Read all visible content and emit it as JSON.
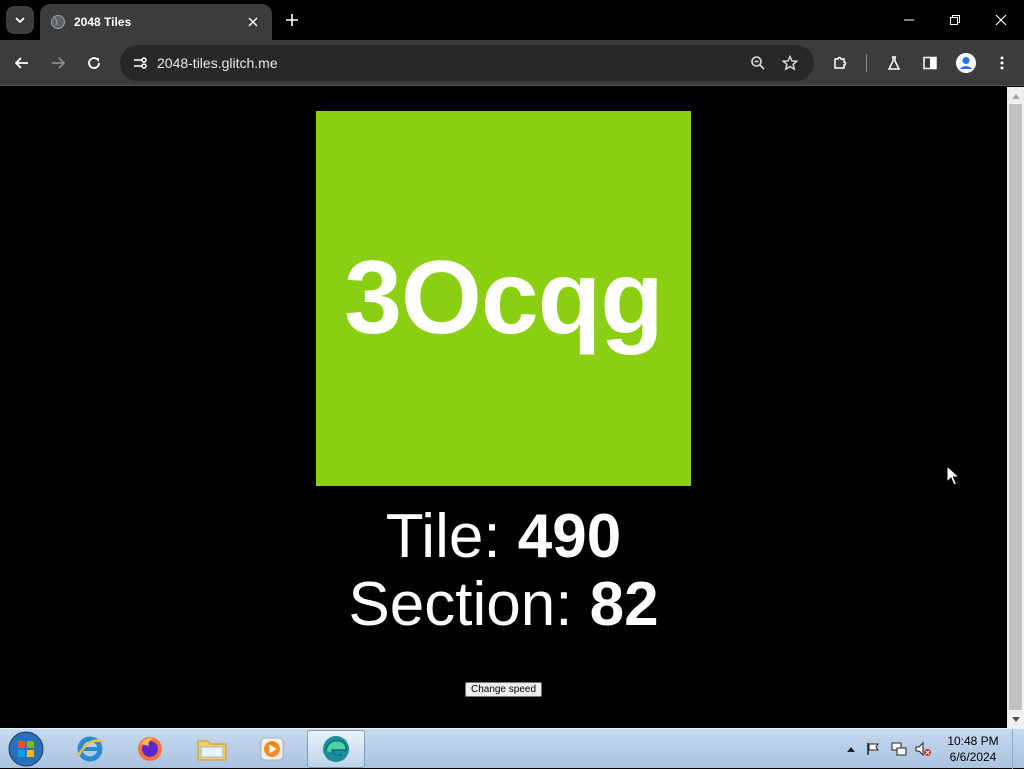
{
  "browser": {
    "tab_title": "2048 Tiles",
    "url": "2048-tiles.glitch.me"
  },
  "game": {
    "tile_text": "3Ocqg",
    "tile_color": "#8bcf12",
    "tile_label": "Tile: ",
    "tile_value": "490",
    "section_label": "Section: ",
    "section_value": "82",
    "change_speed_label": "Change speed"
  },
  "taskbar": {
    "time": "10:48 PM",
    "date": "6/6/2024"
  }
}
